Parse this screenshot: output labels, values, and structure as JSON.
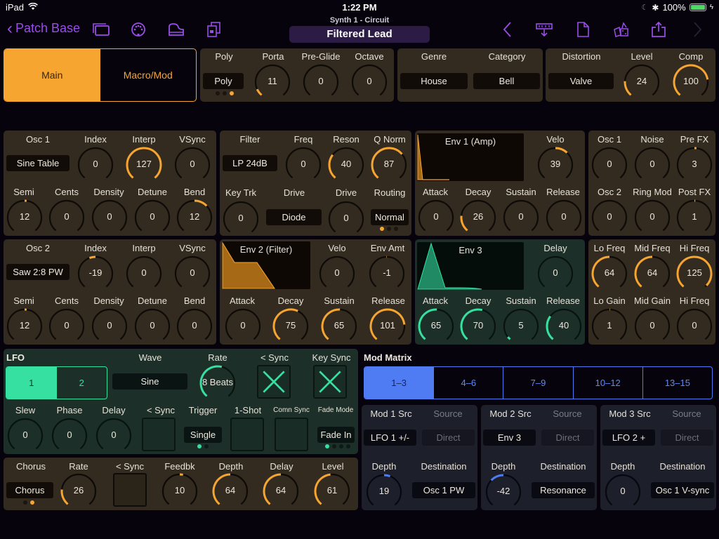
{
  "status_bar": {
    "device": "iPad",
    "time": "1:22 PM",
    "battery": "100%"
  },
  "nav": {
    "back_label": "Patch Base",
    "subtitle": "Synth 1 - Circuit",
    "patch_name": "Filtered Lead",
    "icons": [
      "windows-icon",
      "midi-icon",
      "piano-icon",
      "documents-icon",
      "chevron-left-icon",
      "load-icon",
      "new-document-icon",
      "dice-icon",
      "share-icon",
      "chevron-right-icon"
    ]
  },
  "main_tabs": [
    {
      "label": "Main",
      "active": true
    },
    {
      "label": "Macro/Mod",
      "active": false
    }
  ],
  "voice": {
    "poly_label": "Poly",
    "poly_value": "Poly",
    "porta": {
      "label": "Porta",
      "value": "11",
      "fraction": 0.09
    },
    "preglide": {
      "label": "Pre-Glide",
      "value": "0",
      "fraction": 0
    },
    "octave": {
      "label": "Octave",
      "value": "0",
      "fraction": 0
    }
  },
  "meta": {
    "genre_label": "Genre",
    "genre": "House",
    "category_label": "Category",
    "category": "Bell"
  },
  "distortion": {
    "type_label": "Distortion",
    "type": "Valve",
    "level": {
      "label": "Level",
      "value": "24",
      "fraction": 0.19
    },
    "comp": {
      "label": "Comp",
      "value": "100",
      "fraction": 0.79
    }
  },
  "osc1": {
    "title": "Osc 1",
    "wave": "Sine Table",
    "row1": [
      {
        "label": "Index",
        "value": "0",
        "fraction": 0,
        "bipolar": true
      },
      {
        "label": "Interp",
        "value": "127",
        "fraction": 1
      },
      {
        "label": "VSync",
        "value": "0",
        "fraction": 0
      }
    ],
    "row2": [
      {
        "label": "Semi",
        "value": "12",
        "fraction": 0.05,
        "bipolar": true
      },
      {
        "label": "Cents",
        "value": "0",
        "fraction": 0,
        "bipolar": true
      },
      {
        "label": "Density",
        "value": "0",
        "fraction": 0
      },
      {
        "label": "Detune",
        "value": "0",
        "fraction": 0
      },
      {
        "label": "Bend",
        "value": "12",
        "fraction": 0.33,
        "bipolar": true
      }
    ]
  },
  "osc2": {
    "title": "Osc 2",
    "wave": "Saw 2:8 PW",
    "row1": [
      {
        "label": "Index",
        "value": "-19",
        "fraction": -0.15,
        "bipolar": true
      },
      {
        "label": "Interp",
        "value": "0",
        "fraction": 0
      },
      {
        "label": "VSync",
        "value": "0",
        "fraction": 0
      }
    ],
    "row2": [
      {
        "label": "Semi",
        "value": "12",
        "fraction": 0.05,
        "bipolar": true
      },
      {
        "label": "Cents",
        "value": "0",
        "fraction": 0,
        "bipolar": true
      },
      {
        "label": "Density",
        "value": "0",
        "fraction": 0
      },
      {
        "label": "Detune",
        "value": "0",
        "fraction": 0
      },
      {
        "label": "Bend",
        "value": "0",
        "fraction": 0,
        "bipolar": true
      }
    ]
  },
  "filter": {
    "type_label": "Filter",
    "type": "LP 24dB",
    "freq": {
      "label": "Freq",
      "value": "0",
      "fraction": 0
    },
    "reson": {
      "label": "Reson",
      "value": "40",
      "fraction": 0.31
    },
    "qnorm": {
      "label": "Q Norm",
      "value": "87",
      "fraction": 0.68
    },
    "keytrk": {
      "label": "Key Trk",
      "value": "0",
      "fraction": 0
    },
    "drive_type_label": "Drive",
    "drive_type": "Diode",
    "drive": {
      "label": "Drive",
      "value": "0",
      "fraction": 0
    },
    "routing_label": "Routing",
    "routing": "Normal"
  },
  "env1": {
    "title": "Env 1 (Amp)",
    "velo": {
      "label": "Velo",
      "value": "39",
      "fraction": 0.31,
      "bipolar": true
    },
    "knobs": [
      {
        "label": "Attack",
        "value": "0",
        "fraction": 0
      },
      {
        "label": "Decay",
        "value": "26",
        "fraction": 0.2
      },
      {
        "label": "Sustain",
        "value": "0",
        "fraction": 0
      },
      {
        "label": "Release",
        "value": "0",
        "fraction": 0
      }
    ]
  },
  "env2": {
    "title": "Env 2 (Filter)",
    "velo": {
      "label": "Velo",
      "value": "0",
      "fraction": 0,
      "bipolar": true
    },
    "envamt": {
      "label": "Env Amt",
      "value": "-1",
      "fraction": -0.01,
      "bipolar": true
    },
    "knobs": [
      {
        "label": "Attack",
        "value": "0",
        "fraction": 0
      },
      {
        "label": "Decay",
        "value": "75",
        "fraction": 0.59
      },
      {
        "label": "Sustain",
        "value": "65",
        "fraction": 0.51
      },
      {
        "label": "Release",
        "value": "101",
        "fraction": 0.8
      }
    ]
  },
  "env3": {
    "title": "Env 3",
    "delay": {
      "label": "Delay",
      "value": "0",
      "fraction": 0
    },
    "knobs": [
      {
        "label": "Attack",
        "value": "65",
        "fraction": 0.51
      },
      {
        "label": "Decay",
        "value": "70",
        "fraction": 0.55
      },
      {
        "label": "Sustain",
        "value": "5",
        "fraction": 0.04
      },
      {
        "label": "Release",
        "value": "40",
        "fraction": 0.31
      }
    ]
  },
  "mixer": {
    "row1": [
      {
        "label": "Osc 1",
        "value": "0",
        "fraction": 0
      },
      {
        "label": "Noise",
        "value": "0",
        "fraction": 0
      },
      {
        "label": "Pre FX",
        "value": "3",
        "fraction": 0.05,
        "bipolar": true
      }
    ],
    "row2": [
      {
        "label": "Osc 2",
        "value": "0",
        "fraction": 0
      },
      {
        "label": "Ring Mod",
        "value": "0",
        "fraction": 0
      },
      {
        "label": "Post FX",
        "value": "1",
        "fraction": 0.02,
        "bipolar": true
      }
    ]
  },
  "eq": {
    "row1": [
      {
        "label": "Lo Freq",
        "value": "64",
        "fraction": 0.5
      },
      {
        "label": "Mid Freq",
        "value": "64",
        "fraction": 0.5
      },
      {
        "label": "Hi Freq",
        "value": "125",
        "fraction": 0.98
      }
    ],
    "row2": [
      {
        "label": "Lo Gain",
        "value": "1",
        "fraction": 0.01,
        "bipolar": true
      },
      {
        "label": "Mid Gain",
        "value": "0",
        "fraction": 0,
        "bipolar": true
      },
      {
        "label": "Hi Freq",
        "value": "0",
        "fraction": 0,
        "bipolar": true
      }
    ]
  },
  "lfo": {
    "title": "LFO",
    "tabs": [
      {
        "label": "1",
        "active": true
      },
      {
        "label": "2",
        "active": false
      }
    ],
    "wave_label": "Wave",
    "wave": "Sine",
    "rate": {
      "label": "Rate",
      "value": "8 Beats",
      "fraction": 0.55
    },
    "sync_label": "< Sync",
    "sync_checked": true,
    "keysync_label": "Key Sync",
    "keysync_checked": true,
    "knobs": [
      {
        "label": "Slew",
        "value": "0",
        "fraction": 0
      },
      {
        "label": "Phase",
        "value": "0",
        "fraction": 0
      },
      {
        "label": "Delay",
        "value": "0",
        "fraction": 0
      }
    ],
    "delay_sync_label": "< Sync",
    "delay_sync_checked": false,
    "trigger_label": "Trigger",
    "trigger": "Single",
    "oneshot_label": "1-Shot",
    "oneshot_checked": false,
    "comnsync_label": "Comn Sync",
    "comnsync_checked": false,
    "fademode_label": "Fade Mode",
    "fademode": "Fade In"
  },
  "chorus": {
    "type_label": "Chorus",
    "type": "Chorus",
    "rate": {
      "label": "Rate",
      "value": "26",
      "fraction": 0.2
    },
    "sync_label": "< Sync",
    "sync_checked": false,
    "knobs": [
      {
        "label": "Feedbk",
        "value": "10",
        "fraction": 0.08,
        "bipolar": true
      },
      {
        "label": "Depth",
        "value": "64",
        "fraction": 0.5
      },
      {
        "label": "Delay",
        "value": "64",
        "fraction": 0.5
      },
      {
        "label": "Level",
        "value": "61",
        "fraction": 0.48
      }
    ]
  },
  "mod_matrix": {
    "title": "Mod Matrix",
    "tabs": [
      {
        "label": "1–3",
        "active": true
      },
      {
        "label": "4–6"
      },
      {
        "label": "7–9"
      },
      {
        "label": "10–12"
      },
      {
        "label": "13–15"
      }
    ],
    "slots": [
      {
        "src_label": "Mod 1 Src",
        "src": "LFO 1 +/-",
        "source_label": "Source",
        "source": "Direct",
        "depth_label": "Depth",
        "depth": "19",
        "depth_fraction": 0.15,
        "dest_label": "Destination",
        "dest": "Osc 1 PW"
      },
      {
        "src_label": "Mod 2 Src",
        "src": "Env 3",
        "source_label": "Source",
        "source": "Direct",
        "depth_label": "Depth",
        "depth": "-42",
        "depth_fraction": -0.33,
        "dest_label": "Destination",
        "dest": "Resonance"
      },
      {
        "src_label": "Mod 3 Src",
        "src": "LFO 2 +",
        "source_label": "Source",
        "source": "Direct",
        "depth_label": "Depth",
        "depth": "0",
        "depth_fraction": 0,
        "dest_label": "Destination",
        "dest": "Osc 1 V-sync"
      }
    ]
  },
  "colors": {
    "accent": "#f7a531",
    "lfo_accent": "#35e0a1",
    "mod_accent": "#4f7cf2",
    "nav_accent": "#9a4de8"
  }
}
